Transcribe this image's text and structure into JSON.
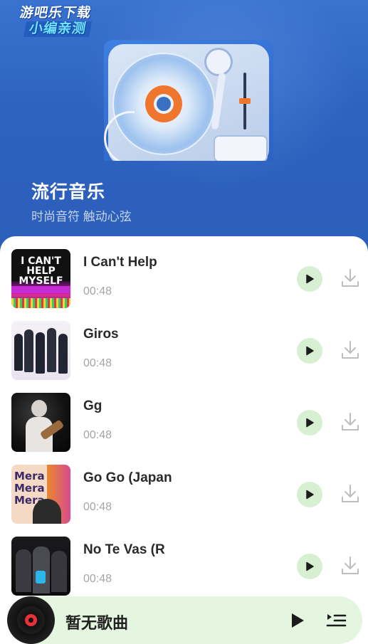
{
  "watermark": {
    "line1": "游吧乐下载",
    "line2": "小编亲测"
  },
  "album": {
    "title": "流行音乐",
    "subtitle": "时尚音符 触动心弦"
  },
  "songs": [
    {
      "title": "I Can't Help",
      "duration": "00:48"
    },
    {
      "title": "Giros",
      "duration": "00:48"
    },
    {
      "title": "Gg",
      "duration": "00:48"
    },
    {
      "title": "Go Go (Japan",
      "duration": "00:48"
    },
    {
      "title": "No Te Vas (R",
      "duration": "00:48"
    }
  ],
  "player": {
    "status": "暂无歌曲"
  },
  "colors": {
    "hero_blue": "#2f66c2",
    "play_button_bg": "#d7f0d2",
    "player_bar_bg": "#e4f6df",
    "disc_label_red": "#e8313a"
  },
  "icons": {
    "play": "play-icon",
    "download": "download-icon",
    "playlist": "playlist-icon"
  }
}
